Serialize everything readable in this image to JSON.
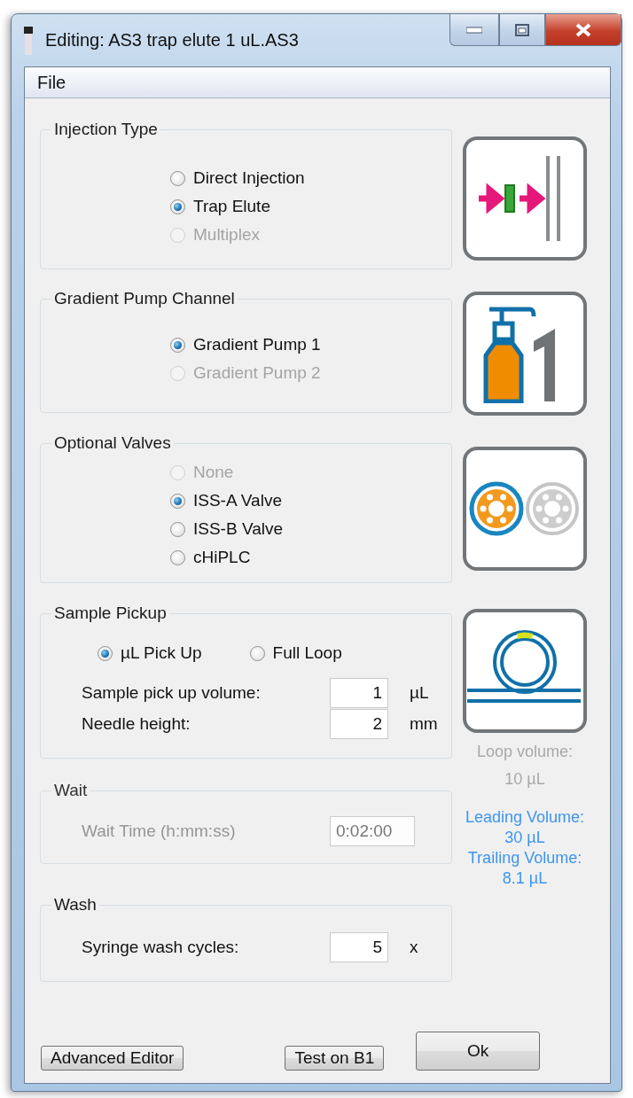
{
  "window": {
    "title": "Editing: AS3 trap elute 1 uL.AS3"
  },
  "menu": [
    {
      "label": "File"
    }
  ],
  "groups": [
    {
      "title": "Injection Type",
      "disabled": false,
      "inline": false,
      "options": [
        {
          "label": "Direct Injection",
          "selected": false,
          "disabled": false
        },
        {
          "label": "Trap Elute",
          "selected": true,
          "disabled": false
        },
        {
          "label": "Multiplex",
          "selected": false,
          "disabled": true
        }
      ]
    },
    {
      "title": "Gradient Pump Channel",
      "disabled": false,
      "inline": false,
      "options": [
        {
          "label": "Gradient Pump 1",
          "selected": true,
          "disabled": false
        },
        {
          "label": "Gradient Pump 2",
          "selected": false,
          "disabled": true
        }
      ]
    },
    {
      "title": "Optional Valves",
      "disabled": false,
      "inline": false,
      "options": [
        {
          "label": "None",
          "selected": false,
          "disabled": true
        },
        {
          "label": "ISS-A Valve",
          "selected": true,
          "disabled": false
        },
        {
          "label": "ISS-B Valve",
          "selected": false,
          "disabled": false
        },
        {
          "label": "cHiPLC",
          "selected": false,
          "disabled": false
        }
      ]
    },
    {
      "title": "Sample Pickup",
      "disabled": false,
      "inline": true,
      "options": [
        {
          "label": "µL Pick Up",
          "selected": true,
          "disabled": false
        },
        {
          "label": "Full Loop",
          "selected": false,
          "disabled": false
        }
      ],
      "fields": [
        {
          "label": "Sample pick up volume:",
          "value": "1",
          "unit": "µL"
        },
        {
          "label": "Needle height:",
          "value": "2",
          "unit": "mm"
        }
      ]
    },
    {
      "title": "Wait",
      "disabled": true,
      "fields": [
        {
          "label": "Wait Time (h:mm:ss)",
          "value": "0:02:00"
        }
      ]
    },
    {
      "title": "Wash",
      "disabled": false,
      "fields": [
        {
          "label": "Syringe wash cycles:",
          "value": "5",
          "unit": "x"
        }
      ]
    }
  ],
  "loop_volume": {
    "disabled": true,
    "lines": [
      "Loop volume:",
      "10 µL"
    ]
  },
  "volumes": [
    "Leading Volume:",
    "30 µL",
    "Trailing Volume:",
    "8.1 µL"
  ],
  "buttons": [
    {
      "label": "Advanced Editor",
      "kind": "compact"
    },
    {
      "label": "Test on B1",
      "kind": "compact"
    },
    {
      "label": "Ok",
      "kind": "large"
    }
  ]
}
